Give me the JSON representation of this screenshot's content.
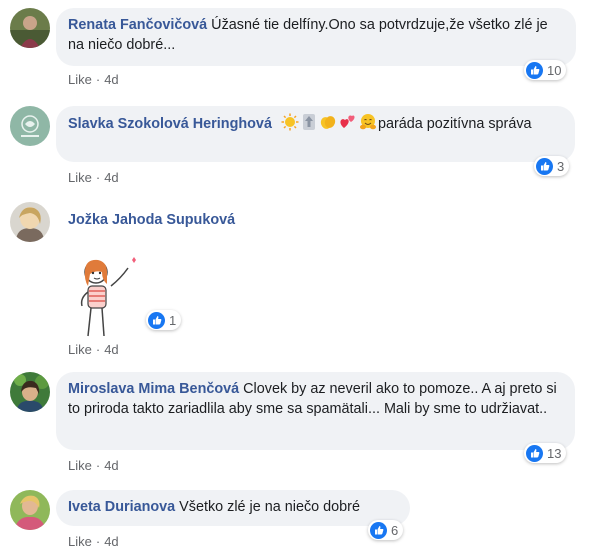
{
  "comments": [
    {
      "author": "Renata Fančovičová",
      "text": "Úžasné tie delfíny.Ono sa potvrdzuje,že všetko zlé je na niečo dobré...",
      "like": "Like",
      "time": "4d",
      "reactions": "10"
    },
    {
      "author": "Slavka Szokolová Heringhová",
      "text": "paráda pozitívna správa",
      "like": "Like",
      "time": "4d",
      "reactions": "3"
    },
    {
      "author": "Jožka Jahoda Supuková",
      "like": "Like",
      "time": "4d",
      "reactions": "1"
    },
    {
      "author": "Miroslava Mima Benčová",
      "text": "Clovek by az neveril ako to pomoze.. A aj preto si to priroda takto zariadlila aby sme sa spamätali... Mali by sme to udržiavat..",
      "like": "Like",
      "time": "4d",
      "reactions": "13"
    },
    {
      "author": "Iveta Durianova",
      "text": "Všetko zlé je na niečo dobré",
      "like": "Like",
      "time": "4d",
      "reactions": "6"
    }
  ],
  "colors": {
    "author": "#385898",
    "bubble": "#f0f2f5",
    "like_blue": "#1877f2",
    "meta": "#65676b"
  },
  "icons": [
    "like-reaction-icon",
    "sun-emoji",
    "up-arrow-emoji",
    "clapping-hands-emoji",
    "hearts-emoji",
    "hugging-face-emoji",
    "girl-waving-sticker"
  ]
}
